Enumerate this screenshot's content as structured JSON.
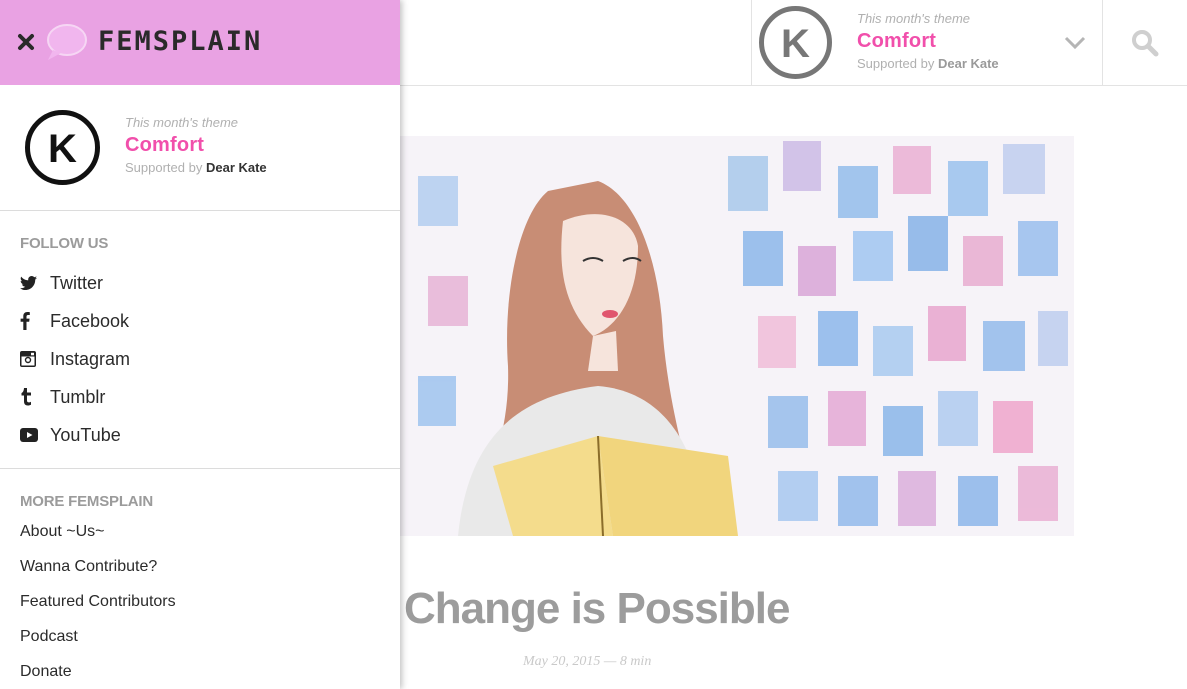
{
  "theme": {
    "kicker": "This month's theme",
    "name": "Comfort",
    "sponsor_prefix": "Supported by",
    "sponsor_name": "Dear Kate",
    "accent_color": "#f14fab"
  },
  "header": {
    "brand": "FEMSPLAIN",
    "brand_bg": "#e9a2e3"
  },
  "icons": {
    "close": "close-icon",
    "logo": "speech-bubble-logo",
    "sponsor_logo": "k-circle-logo",
    "chevron": "chevron-down-icon",
    "search": "search-icon"
  },
  "follow": {
    "title": "FOLLOW US",
    "items": [
      {
        "label": "Twitter",
        "icon": "twitter-icon"
      },
      {
        "label": "Facebook",
        "icon": "facebook-icon"
      },
      {
        "label": "Instagram",
        "icon": "instagram-icon"
      },
      {
        "label": "Tumblr",
        "icon": "tumblr-icon"
      },
      {
        "label": "YouTube",
        "icon": "youtube-icon"
      }
    ]
  },
  "more": {
    "title": "MORE FEMSPLAIN",
    "items": [
      "About ~Us~",
      "Wanna Contribute?",
      "Featured Contributors",
      "Podcast",
      "Donate"
    ]
  },
  "post": {
    "title": "Change is Possible",
    "meta": "May 20, 2015 — 8 min"
  }
}
